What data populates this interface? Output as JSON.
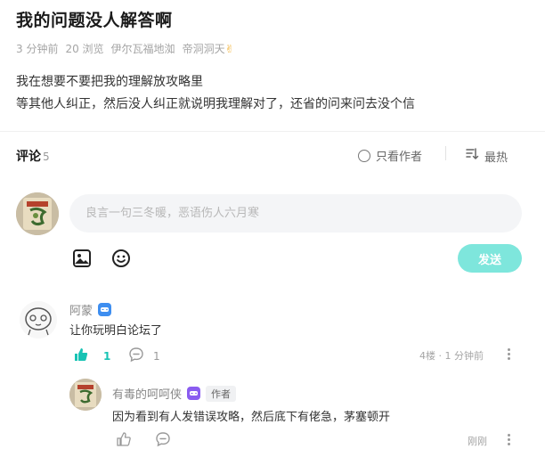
{
  "post": {
    "title": "我的问题没人解答啊",
    "meta": {
      "time": "3 分钟前",
      "views": "20 浏览",
      "location": "伊尔瓦福地洳",
      "forum": "帝洞洞天"
    },
    "body_lines": [
      "我在想要不要把我的理解放攻略里",
      "等其他人纠正，然后没人纠正就说明我理解对了，还省的问来问去没个信"
    ]
  },
  "comments_header": {
    "label": "评论",
    "count": "5",
    "only_author": "只看作者",
    "sort": "最热"
  },
  "composer": {
    "placeholder": "良言一句三冬暖，恶语伤人六月寒",
    "send_label": "发送"
  },
  "comments": [
    {
      "author": "阿蒙",
      "text": "让你玩明白论坛了",
      "likes": "1",
      "replies": "1",
      "floor_time": "4楼 · 1 分钟前"
    }
  ],
  "reply": {
    "author": "有毒的呵呵侠",
    "author_tag": "作者",
    "text": "因为看到有人发错误攻略，然后底下有佬急，茅塞顿开",
    "time": "刚刚"
  },
  "colors": {
    "accent": "#18c3b4",
    "send_button": "#7ee6dc",
    "badge_blue": "#3e8ef0",
    "badge_purple": "#8a5cf0"
  }
}
